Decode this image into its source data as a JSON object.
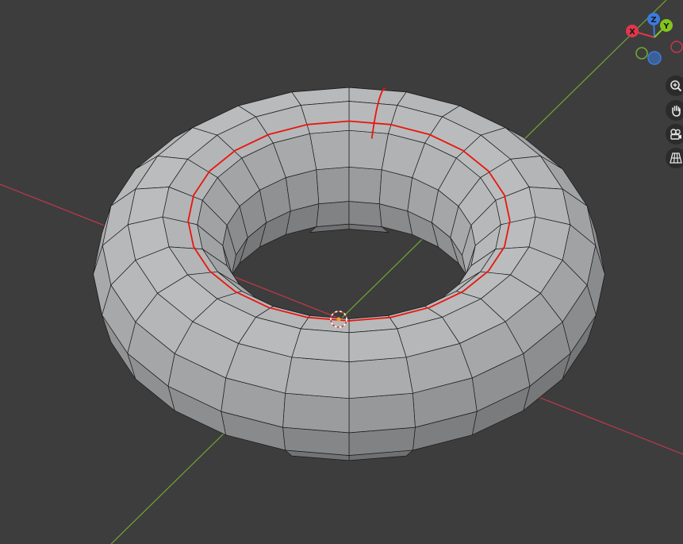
{
  "viewport": {
    "background": "#3d3d3d",
    "grid_axis_x_color": "#c0394a",
    "grid_axis_y_color": "#74a632",
    "selected_edge_color": "#e8170e",
    "wire_color": "#1a1a1a"
  },
  "gizmo": {
    "x_label": "X",
    "y_label": "Y",
    "z_label": "Z",
    "x_color": "#e0374a",
    "y_color": "#82c61c",
    "z_color": "#3b7be0"
  },
  "nav_buttons": [
    {
      "name": "zoom-in-icon"
    },
    {
      "name": "hand-pan-icon"
    },
    {
      "name": "camera-view-icon"
    },
    {
      "name": "perspective-grid-icon"
    }
  ]
}
